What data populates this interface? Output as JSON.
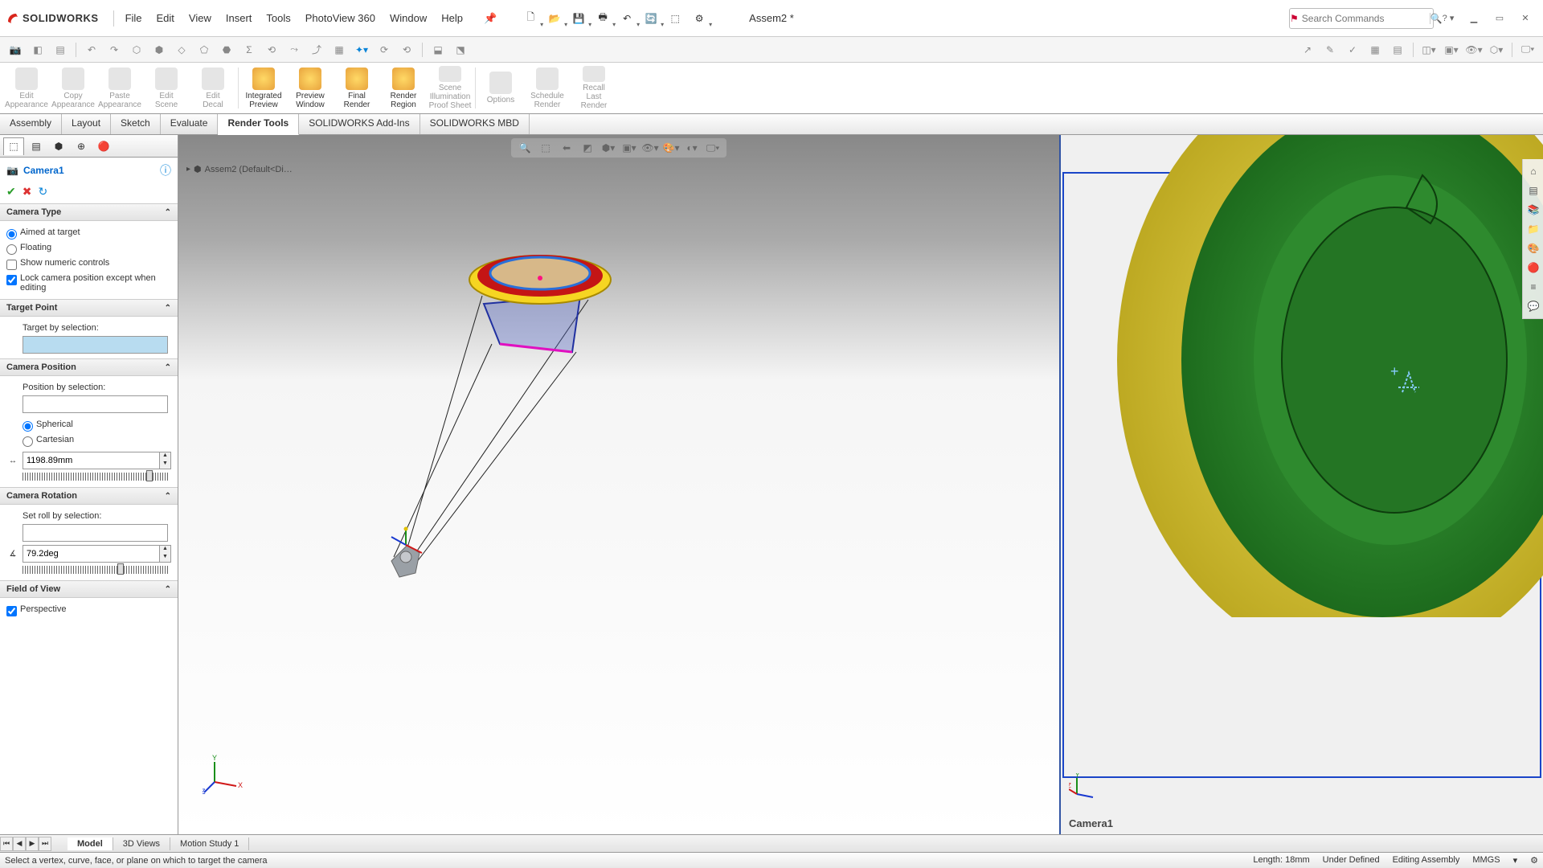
{
  "app": {
    "logo_text": "SOLIDWORKS",
    "doc_title": "Assem2 *"
  },
  "menu": [
    "File",
    "Edit",
    "View",
    "Insert",
    "Tools",
    "PhotoView 360",
    "Window",
    "Help"
  ],
  "search": {
    "placeholder": "Search Commands"
  },
  "ribbon": [
    {
      "label": "Edit Appearance",
      "enabled": false
    },
    {
      "label": "Copy Appearance",
      "enabled": false
    },
    {
      "label": "Paste Appearance",
      "enabled": false
    },
    {
      "label": "Edit Scene",
      "enabled": false
    },
    {
      "label": "Edit Decal",
      "enabled": false
    },
    {
      "label": "Integrated Preview",
      "enabled": true
    },
    {
      "label": "Preview Window",
      "enabled": true
    },
    {
      "label": "Final Render",
      "enabled": true
    },
    {
      "label": "Render Region",
      "enabled": true
    },
    {
      "label": "Scene Illumination Proof Sheet",
      "enabled": false
    },
    {
      "label": "Options",
      "enabled": false
    },
    {
      "label": "Schedule Render",
      "enabled": false
    },
    {
      "label": "Recall Last Render",
      "enabled": false
    }
  ],
  "tabs": [
    "Assembly",
    "Layout",
    "Sketch",
    "Evaluate",
    "Render Tools",
    "SOLIDWORKS Add-Ins",
    "SOLIDWORKS MBD"
  ],
  "tabs_active": 4,
  "feature_panel": {
    "title": "Camera1",
    "sections": {
      "camera_type": {
        "title": "Camera Type",
        "aimed": "Aimed at target",
        "floating": "Floating",
        "show_numeric": "Show numeric controls",
        "lock_camera": "Lock camera position except when editing"
      },
      "target_point": {
        "title": "Target Point",
        "label": "Target by selection:"
      },
      "camera_position": {
        "title": "Camera Position",
        "label": "Position by selection:",
        "spherical": "Spherical",
        "cartesian": "Cartesian",
        "distance": "1198.89mm"
      },
      "camera_rotation": {
        "title": "Camera Rotation",
        "label": "Set roll by selection:",
        "angle": "79.2deg"
      },
      "fov": {
        "title": "Field of View",
        "perspective": "Perspective"
      }
    }
  },
  "breadcrumb": "Assem2 (Default<Di…",
  "camera_view_label": "Camera1",
  "bottom_tabs": [
    "Model",
    "3D Views",
    "Motion Study 1"
  ],
  "bottom_tabs_active": 0,
  "status": {
    "hint": "Select a vertex, curve, face, or plane on which to target the camera",
    "length": "Length: 18mm",
    "underdefined": "Under Defined",
    "mode": "Editing Assembly",
    "units": "MMGS"
  }
}
